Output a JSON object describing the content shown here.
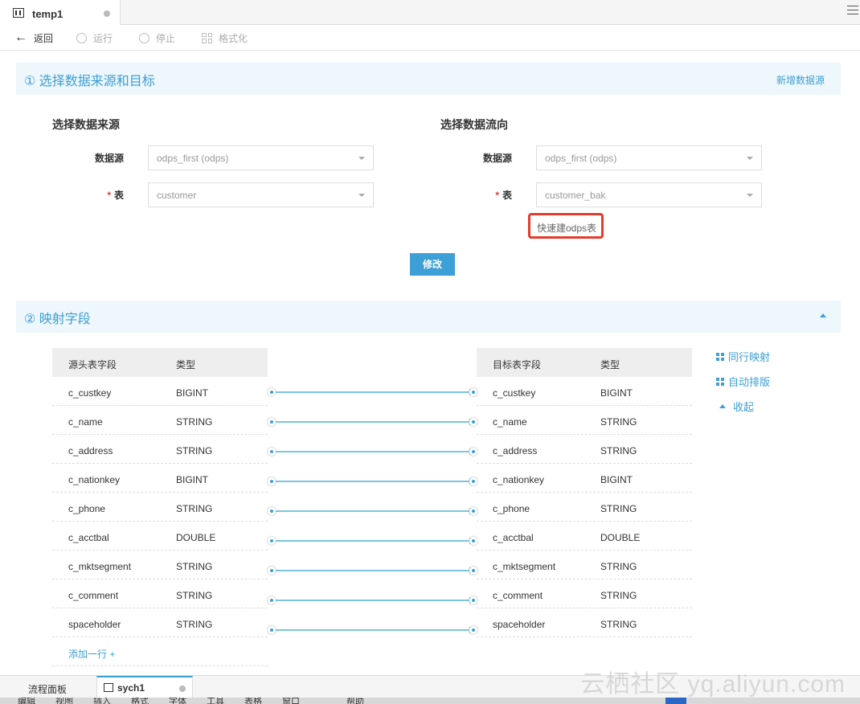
{
  "tabs": {
    "active_title": "temp1"
  },
  "toolbar": {
    "back": "返回",
    "run": "运行",
    "stop": "停止",
    "format": "格式化"
  },
  "section1": {
    "title": "① 选择数据来源和目标",
    "add_source_link": "新增数据源",
    "source": {
      "heading": "选择数据来源",
      "ds_label": "数据源",
      "ds_value": "odps_first (odps)",
      "table_label": "表",
      "table_value": "customer"
    },
    "target": {
      "heading": "选择数据流向",
      "ds_label": "数据源",
      "ds_value": "odps_first (odps)",
      "table_label": "表",
      "table_value": "customer_bak",
      "quick_create": "快速建odps表"
    },
    "required_mark": "*",
    "modify_button": "修改"
  },
  "section2": {
    "title": "② 映射字段",
    "source_headers": [
      "源头表字段",
      "类型"
    ],
    "target_headers": [
      "目标表字段",
      "类型"
    ],
    "rows": [
      {
        "field": "c_custkey",
        "type": "BIGINT"
      },
      {
        "field": "c_name",
        "type": "STRING"
      },
      {
        "field": "c_address",
        "type": "STRING"
      },
      {
        "field": "c_nationkey",
        "type": "BIGINT"
      },
      {
        "field": "c_phone",
        "type": "STRING"
      },
      {
        "field": "c_acctbal",
        "type": "DOUBLE"
      },
      {
        "field": "c_mktsegment",
        "type": "STRING"
      },
      {
        "field": "c_comment",
        "type": "STRING"
      },
      {
        "field": "spaceholder",
        "type": "STRING"
      }
    ],
    "add_row": "添加一行 +",
    "actions": {
      "same_row_map": "同行映射",
      "auto_layout": "自动排版",
      "collapse": "收起"
    }
  },
  "bottom_tabs": {
    "flow_panel": "流程面板",
    "active": "sych1"
  },
  "watermark": "云栖社区 yq.aliyun.com",
  "os_menu": [
    "编辑",
    "视图",
    "插入",
    "格式",
    "字体",
    "工具",
    "表格",
    "窗口",
    "帮助"
  ],
  "colors": {
    "accent": "#3c9fd6",
    "highlight_border": "#e33b2c",
    "header_bg": "#eef7fb"
  }
}
